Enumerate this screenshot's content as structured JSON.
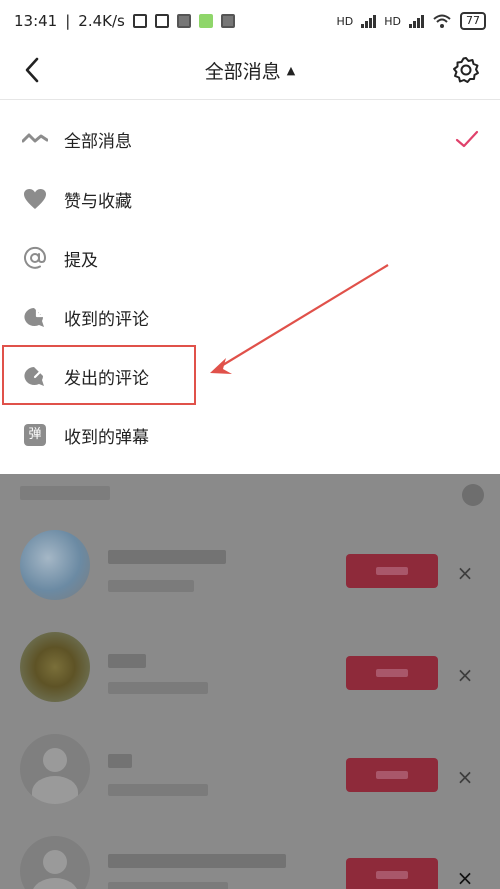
{
  "status_bar": {
    "time": "13:41",
    "speed": "2.4K/s",
    "hd1": "HD",
    "hd2": "HD",
    "battery": "77"
  },
  "header": {
    "title": "全部消息",
    "title_caret": "▲"
  },
  "menu": {
    "items": [
      {
        "label": "全部消息",
        "icon": "wave-icon",
        "selected": true
      },
      {
        "label": "赞与收藏",
        "icon": "heart-icon",
        "selected": false
      },
      {
        "label": "提及",
        "icon": "at-icon",
        "selected": false
      },
      {
        "label": "收到的评论",
        "icon": "comment-in-icon",
        "selected": false
      },
      {
        "label": "发出的评论",
        "icon": "comment-out-icon",
        "selected": false
      },
      {
        "label": "收到的弹幕",
        "icon": "danmaku-icon",
        "selected": false
      }
    ],
    "danmaku_glyph": "弹"
  },
  "list": {
    "close_glyph": "×"
  },
  "colors": {
    "accent": "#e0514a",
    "check": "#e0416b",
    "icon_gray": "#8c8c8c"
  }
}
